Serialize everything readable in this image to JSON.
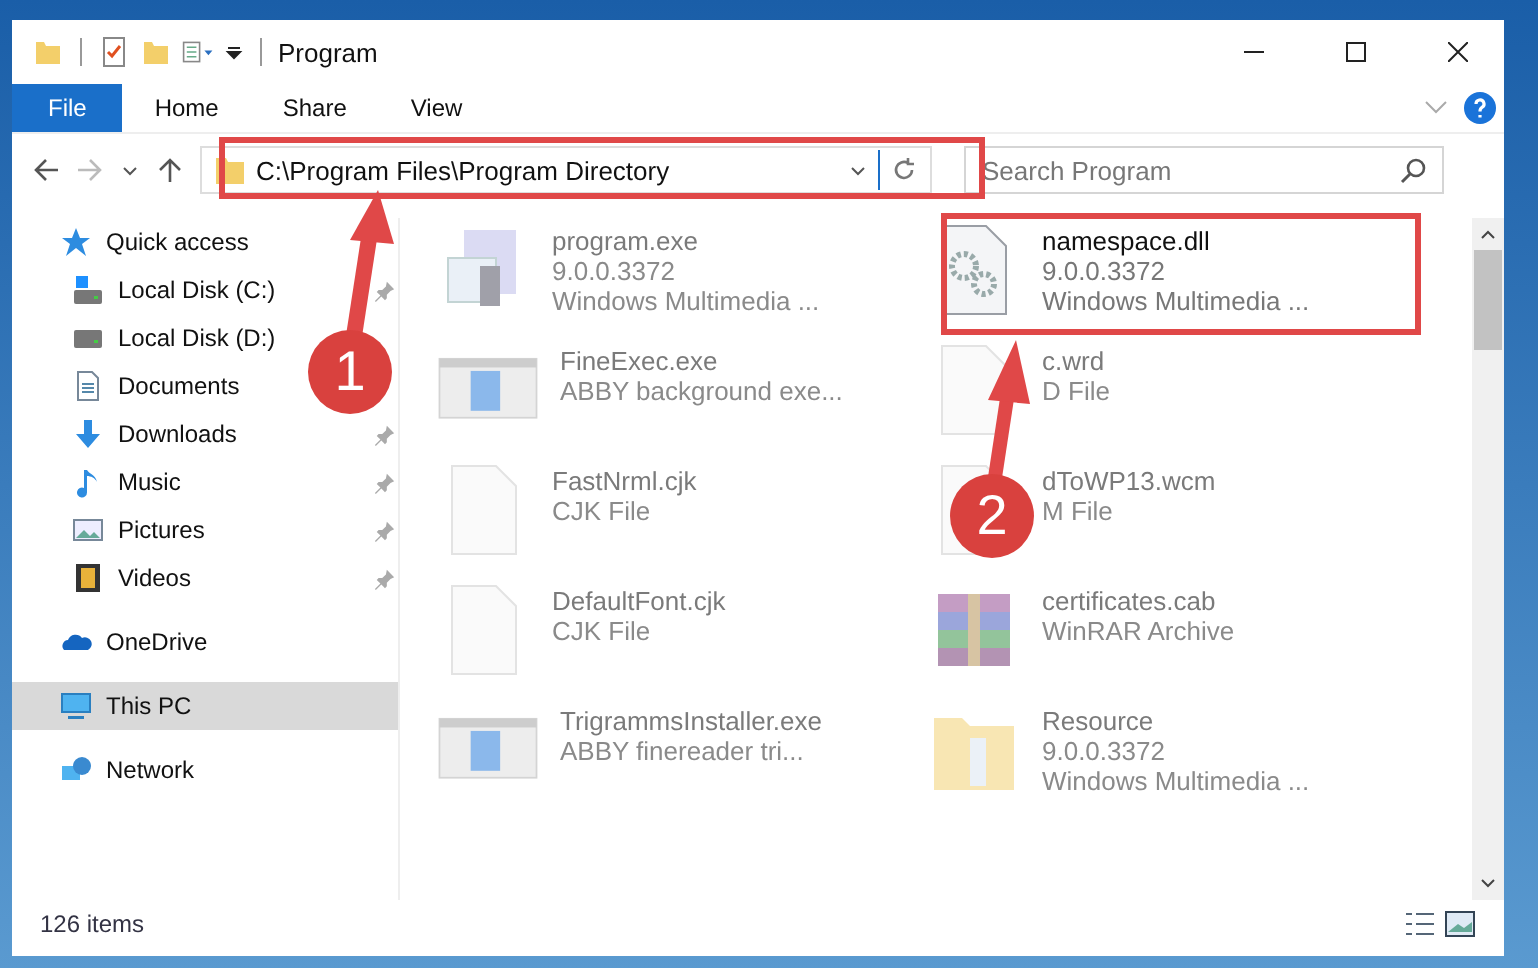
{
  "window": {
    "title": "Program"
  },
  "ribbon_tabs": [
    {
      "label": "File",
      "selected": true
    },
    {
      "label": "Home",
      "selected": false
    },
    {
      "label": "Share",
      "selected": false
    },
    {
      "label": "View",
      "selected": false
    }
  ],
  "address": {
    "path": "C:\\Program Files\\Program Directory"
  },
  "search": {
    "placeholder": "Search Program"
  },
  "sidebar": {
    "items": [
      {
        "label": "Quick access",
        "kind": "star",
        "selected": false,
        "children": [
          {
            "label": "Local Disk (C:)",
            "kind": "drive-c",
            "pinned": true
          },
          {
            "label": "Local Disk (D:)",
            "kind": "drive",
            "pinned": false
          },
          {
            "label": "Documents",
            "kind": "documents",
            "pinned": false
          },
          {
            "label": "Downloads",
            "kind": "downloads",
            "pinned": true
          },
          {
            "label": "Music",
            "kind": "music",
            "pinned": true
          },
          {
            "label": "Pictures",
            "kind": "pictures",
            "pinned": true
          },
          {
            "label": "Videos",
            "kind": "videos",
            "pinned": true
          }
        ]
      },
      {
        "label": "OneDrive",
        "kind": "cloud",
        "selected": false
      },
      {
        "label": "This PC",
        "kind": "pc",
        "selected": true
      },
      {
        "label": "Network",
        "kind": "network",
        "selected": false
      }
    ]
  },
  "files": [
    {
      "kind": "program",
      "blurred": true,
      "lines": [
        "program.exe",
        "9.0.0.3372",
        "Windows Multimedia ..."
      ]
    },
    {
      "kind": "settings-file",
      "blurred": false,
      "lines": [
        "namespace.dll",
        "9.0.0.3372",
        "Windows Multimedia ..."
      ]
    },
    {
      "kind": "app-window",
      "blurred": true,
      "lines": [
        "FineExec.exe",
        "ABBY background exe..."
      ]
    },
    {
      "kind": "document",
      "blurred": true,
      "lines": [
        "c.wrd",
        "D File"
      ]
    },
    {
      "kind": "document",
      "blurred": true,
      "lines": [
        "FastNrml.cjk",
        "CJK File"
      ]
    },
    {
      "kind": "document",
      "blurred": true,
      "lines": [
        "dToWP13.wcm",
        "M File"
      ]
    },
    {
      "kind": "document",
      "blurred": true,
      "lines": [
        "DefaultFont.cjk",
        "CJK File"
      ]
    },
    {
      "kind": "archive",
      "blurred": true,
      "lines": [
        "certificates.cab",
        "WinRAR Archive"
      ]
    },
    {
      "kind": "app-window",
      "blurred": true,
      "lines": [
        "TrigrammsInstaller.exe",
        "ABBY finereader tri..."
      ]
    },
    {
      "kind": "folder",
      "blurred": true,
      "lines": [
        "Resource",
        "9.0.0.3372",
        "Windows Multimedia ..."
      ]
    }
  ],
  "status_bar": {
    "item_count": "126 items"
  },
  "annotations": [
    {
      "label": "1"
    },
    {
      "label": "2"
    }
  ]
}
